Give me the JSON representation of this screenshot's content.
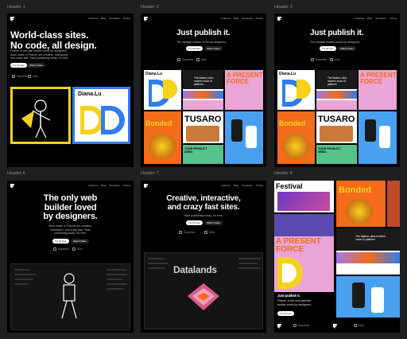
{
  "frames": [
    {
      "label": "Header 1",
      "headline": "World-class sites.\nNo code, all design.",
      "sub": "Framer is the site builder loved by designers.\nSites made in Framer are creative, interactive,\nand crazy fast. Start publishing today. It's free.",
      "btn1": "Try for free",
      "btn2": "Watch Video",
      "tile_text": "Diana.Lu"
    },
    {
      "label": "Header 2",
      "headline": "Just publish it.",
      "sub": "The website builder loved by designers.",
      "btn1": "Try for free",
      "btn2": "Watch Video",
      "tiles": [
        "Diana.Lu",
        "A PRESENT FORCE",
        "Bonded",
        "TUSARO",
        "The fastest, ultra-modern voice AI platform",
        "YOUR PRODUCT DEMO"
      ]
    },
    {
      "label": "Header 3",
      "headline": "Just publish it.",
      "sub": "The website builder loved by designers.",
      "btn1": "Try for free",
      "btn2": "Watch Video",
      "tiles": [
        "Diana.Lu",
        "A PRESENT FORCE",
        "Bonded",
        "TUSARO",
        "The fastest, ultra-modern voice AI platform",
        "YOUR PRODUCT DEMO"
      ]
    },
    {
      "label": "Header 6",
      "headline": "The only web\nbuilder loved\nby designers.",
      "sub": "Sites made in Framer are creative,\ninteractive, and crazy fast. Start\npublishing today. It's free.",
      "btn1": "Try for free",
      "btn2": "Watch Video"
    },
    {
      "label": "Header 7",
      "headline": "Creative, interactive,\nand crazy fast sites.",
      "sub": "Start publishing today. It's free.",
      "btn1": "Try for free",
      "btn2": "Watch Video",
      "tile_text": "Datalands"
    },
    {
      "label": "Header 8",
      "headline": "Just publish it.",
      "sub": "Framer is the only website\nbuilder loved by designers.",
      "btn1": "Try for free",
      "tiles": [
        "Festival",
        "Bonded",
        "A PRESENT FORCE",
        "The fastest, ultra-modern voice AI platform"
      ]
    }
  ],
  "nav": [
    "Features",
    "Blog",
    "Templates",
    "Pricing"
  ],
  "brands": [
    "Superlist",
    "Miro"
  ],
  "colors": {
    "yellow": "#f7d21c",
    "blue": "#2f7df0",
    "pink": "#e9a6d6",
    "orange": "#f36b1c",
    "green": "#57c28a",
    "purple": "#9b7be8"
  }
}
